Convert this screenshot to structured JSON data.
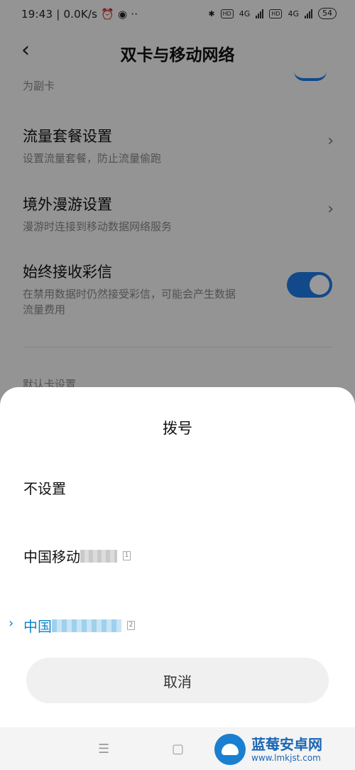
{
  "status_bar": {
    "time": "19:43",
    "speed": "0.0K/s",
    "battery": "54",
    "net1": "4G",
    "net2": "4G",
    "hd": "HD"
  },
  "header": {
    "title": "双卡与移动网络",
    "back_icon": "back-arrow-icon"
  },
  "background": {
    "fragment_text": "为副卡",
    "rows": [
      {
        "title": "流量套餐设置",
        "subtitle": "设置流量套餐，防止流量偷跑"
      },
      {
        "title": "境外漫游设置",
        "subtitle": "漫游时连接到移动数据网络服务"
      },
      {
        "title": "始终接收彩信",
        "subtitle_line1": "在禁用数据时仍然接受彩信，可能会产生数据",
        "subtitle_line2": "流量费用",
        "toggle_on": true
      }
    ],
    "section_header": "默认卡设置"
  },
  "sheet": {
    "title": "拨号",
    "options": [
      {
        "label": "不设置",
        "selected": false
      },
      {
        "label": "中国移动",
        "slot": "1",
        "selected": false
      },
      {
        "label": "中国",
        "slot": "2",
        "selected": true
      }
    ],
    "cancel_label": "取消"
  },
  "watermark": {
    "name": "蓝莓安卓网",
    "url": "www.lmkjst.com"
  },
  "colors": {
    "accent": "#1f7ae8",
    "selected": "#0d84c8"
  }
}
